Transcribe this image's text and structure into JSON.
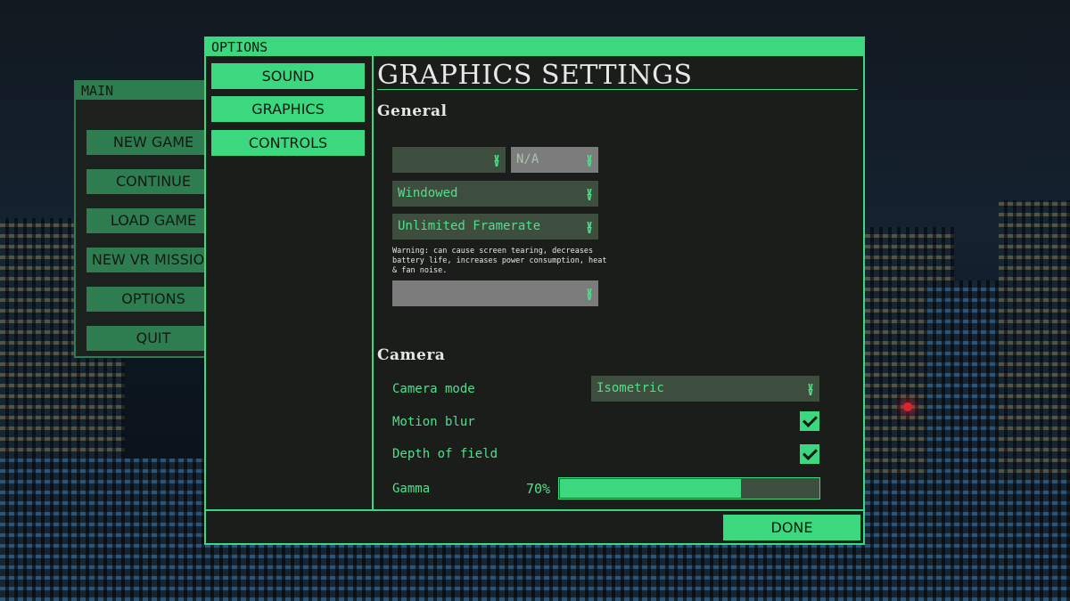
{
  "main_menu": {
    "title": "MAIN",
    "buttons": [
      "NEW GAME",
      "CONTINUE",
      "LOAD GAME",
      "NEW VR MISSION",
      "OPTIONS",
      "QUIT"
    ]
  },
  "options": {
    "title": "OPTIONS",
    "tabs": [
      "SOUND",
      "GRAPHICS",
      "CONTROLS"
    ],
    "active_tab": "GRAPHICS",
    "heading": "GRAPHICS SETTINGS",
    "general": {
      "heading": "General",
      "resolution_value": "",
      "refresh_value": "N/A",
      "window_mode": "Windowed",
      "framerate": "Unlimited Framerate",
      "framerate_warning": "Warning: can cause screen tearing, decreases battery life, increases power consumption, heat & fan noise.",
      "extra_dropdown_value": ""
    },
    "camera": {
      "heading": "Camera",
      "camera_mode_label": "Camera mode",
      "camera_mode_value": "Isometric",
      "motion_blur_label": "Motion blur",
      "motion_blur": true,
      "dof_label": "Depth of field",
      "dof": true,
      "gamma_label": "Gamma",
      "gamma_text": "70%",
      "gamma_value": 0.7
    },
    "done_label": "DONE"
  },
  "colors": {
    "accent": "#3bd87f",
    "accent_dim": "#2e7d50",
    "panel": "#1b1d1b",
    "field": "#3d4e3f",
    "disabled_field": "#7c7c7c"
  }
}
